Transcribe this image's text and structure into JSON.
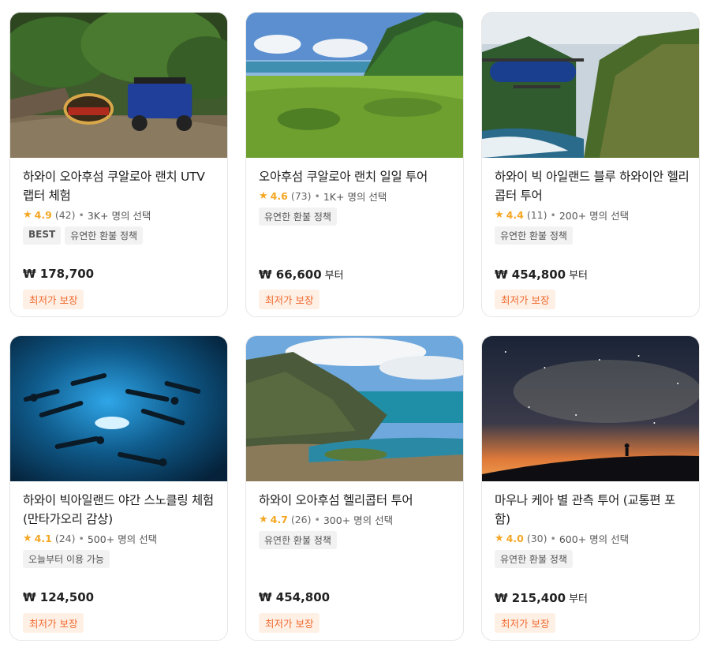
{
  "cards": [
    {
      "image": "jurassic-park-utv-photo",
      "title": "하와이 오아후섬 쿠알로아 랜치 UTV 랩터 체험",
      "rating": "4.9",
      "reviews": "(42)",
      "chosen": "3K+ 명의 선택",
      "chips": [
        "BEST",
        "유연한 환불 정책"
      ],
      "price": "₩ 178,700",
      "price_suffix": "",
      "badge": "최저가 보장"
    },
    {
      "image": "kualoa-valley-photo",
      "title": "오아후섬 쿠알로아 랜치 일일 투어",
      "rating": "4.6",
      "reviews": "(73)",
      "chosen": "1K+ 명의 선택",
      "chips": [
        "유연한 환불 정책"
      ],
      "price": "₩ 66,600",
      "price_suffix": "부터",
      "badge": "최저가 보장"
    },
    {
      "image": "blue-helicopter-photo",
      "title": "하와이 빅 아일랜드 블루 하와이안 헬리콥터 투어",
      "rating": "4.4",
      "reviews": "(11)",
      "chosen": "200+ 명의 선택",
      "chips": [
        "유연한 환불 정책"
      ],
      "price": "₩ 454,800",
      "price_suffix": "부터",
      "badge": "최저가 보장"
    },
    {
      "image": "manta-ray-night-snorkel-photo",
      "title": "하와이 빅아일랜드 야간 스노클링 체험 (만타가오리 감상)",
      "rating": "4.1",
      "reviews": "(24)",
      "chosen": "500+ 명의 선택",
      "chips": [
        "오늘부터 이용 가능"
      ],
      "price": "₩ 124,500",
      "price_suffix": "",
      "badge": "최저가 보장"
    },
    {
      "image": "oahu-coast-aerial-photo",
      "title": "하와이 오아후섬 헬리콥터 투어",
      "rating": "4.7",
      "reviews": "(26)",
      "chosen": "300+ 명의 선택",
      "chips": [
        "유연한 환불 정책"
      ],
      "price": "₩ 454,800",
      "price_suffix": "",
      "badge": "최저가 보장"
    },
    {
      "image": "mauna-kea-stars-photo",
      "title": "마우나 케아 별 관측 투어 (교통편 포함)",
      "rating": "4.0",
      "reviews": "(30)",
      "chosen": "600+ 명의 선택",
      "chips": [
        "유연한 환불 정책"
      ],
      "price": "₩ 215,400",
      "price_suffix": "부터",
      "badge": "최저가 보장"
    }
  ],
  "colors": {
    "star": "#f5a623",
    "badge_text": "#f06a2e",
    "badge_bg": "#fff0e6"
  }
}
